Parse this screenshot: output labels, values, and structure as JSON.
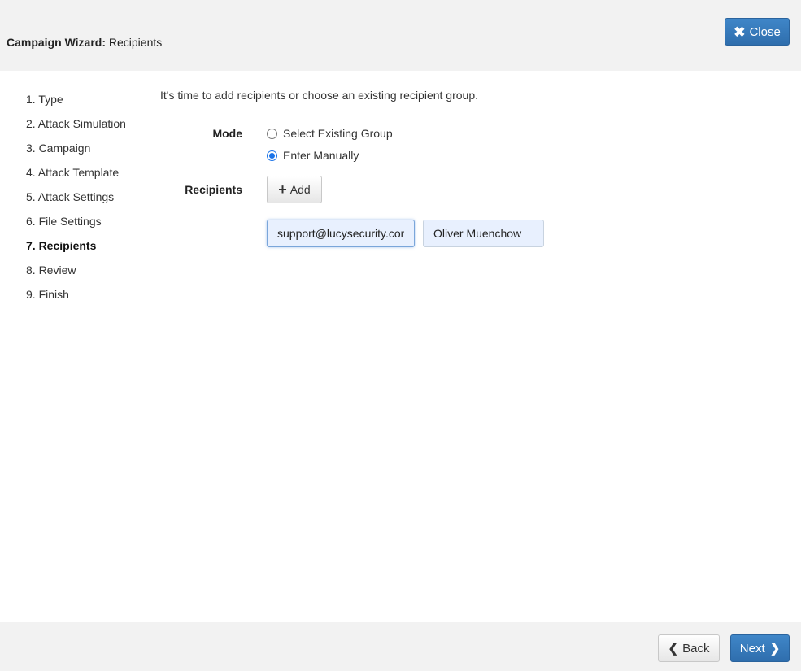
{
  "header": {
    "title_strong": "Campaign Wizard:",
    "title_rest": " Recipients",
    "close_label": "Close",
    "close_icon": "✖"
  },
  "steps": [
    "1. Type",
    "2. Attack Simulation",
    "3. Campaign",
    "4. Attack Template",
    "5. Attack Settings",
    "6. File Settings",
    "7. Recipients",
    "8. Review",
    "9. Finish"
  ],
  "active_step": 6,
  "main": {
    "intro": "It's time to add recipients or choose an existing recipient group.",
    "mode_label": "Mode",
    "mode_options": [
      "Select Existing Group",
      "Enter Manually"
    ],
    "mode_selected": "Enter Manually",
    "recipients_label": "Recipients",
    "add_label": "Add",
    "email_value": "support@lucysecurity.com",
    "name_value": "Oliver Muenchow"
  },
  "footer": {
    "back_label": "Back",
    "next_label": "Next"
  },
  "colors": {
    "primary": "#3a7ebf",
    "header_bg": "#f2f2f2",
    "radio_accent": "#1a73e8"
  }
}
